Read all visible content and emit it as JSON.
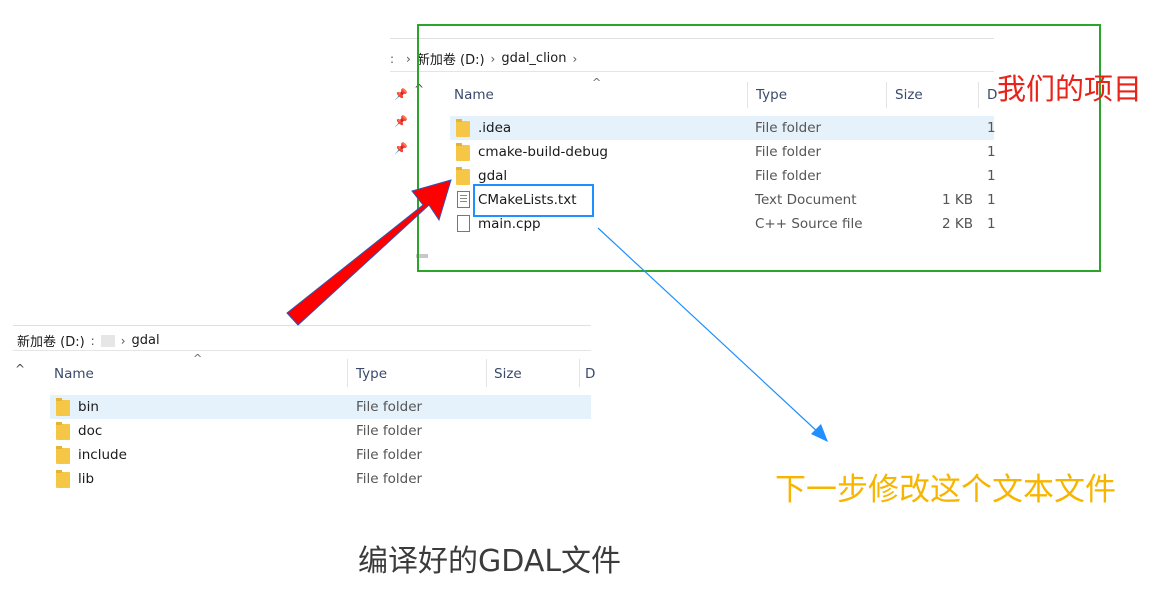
{
  "top_window": {
    "breadcrumb": {
      "drive": "新加卷 (D:)",
      "folder": "gdal_clion"
    },
    "columns": {
      "name": "Name",
      "type": "Type",
      "size": "Size",
      "date_cut": "D"
    },
    "files": [
      {
        "name": ".idea",
        "type": "File folder",
        "size": "",
        "icon": "folder-icon",
        "trail": "1"
      },
      {
        "name": "cmake-build-debug",
        "type": "File folder",
        "size": "",
        "icon": "folder-icon",
        "trail": "1"
      },
      {
        "name": "gdal",
        "type": "File folder",
        "size": "",
        "icon": "folder-icon",
        "trail": "1"
      },
      {
        "name": "CMakeLists.txt",
        "type": "Text Document",
        "size": "1 KB",
        "icon": "text-file-icon",
        "trail": "1"
      },
      {
        "name": "main.cpp",
        "type": "C++ Source file",
        "size": "2 KB",
        "icon": "file-icon",
        "trail": "1"
      }
    ]
  },
  "bottom_window": {
    "breadcrumb": {
      "drive": "新加卷 (D:)",
      "folder": "gdal"
    },
    "columns": {
      "name": "Name",
      "type": "Type",
      "size": "Size",
      "date_cut": "D"
    },
    "files": [
      {
        "name": "bin",
        "type": "File folder",
        "icon": "folder-icon"
      },
      {
        "name": "doc",
        "type": "File folder",
        "icon": "folder-icon"
      },
      {
        "name": "include",
        "type": "File folder",
        "icon": "folder-icon"
      },
      {
        "name": "lib",
        "type": "File folder",
        "icon": "folder-icon"
      }
    ]
  },
  "annotations": {
    "our_project": "我们的项目",
    "next_step": "下一步修改这个文本文件",
    "compiled_gdal": "编译好的GDAL文件",
    "colors": {
      "project_label": "#e8231a",
      "next_step": "#f7b500",
      "green_box": "#2aa52a",
      "blue": "#1e90ff",
      "arrow_red": "#ff0000"
    }
  }
}
